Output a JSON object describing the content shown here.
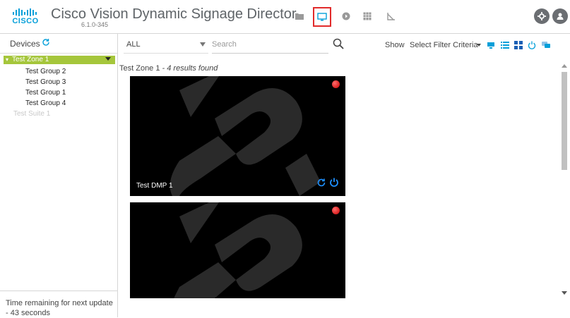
{
  "header": {
    "logo_text": "CISCO",
    "title": "Cisco Vision Dynamic Signage Director",
    "version": "6.1.0-345",
    "nav_icons": [
      "folder-icon",
      "monitor-icon",
      "play-icon",
      "calendar-icon",
      "chart-icon"
    ],
    "active_nav": "monitor-icon",
    "right_icons": [
      "settings-icon",
      "user-icon"
    ],
    "accent_color": "#049fd9",
    "highlight_color": "#e12b2b"
  },
  "sidebar": {
    "title": "Devices",
    "zone": {
      "label": "Test Zone 1",
      "color": "#a5c63b"
    },
    "groups": [
      "Test Group 2",
      "Test Group 3",
      "Test Group 1",
      "Test Group 4"
    ],
    "suite": "Test Suite 1",
    "status_text": "Time remaining for next update - 43 seconds"
  },
  "toolbar": {
    "filter_value": "ALL",
    "search_placeholder": "Search",
    "show_label": "Show",
    "criteria_label": "Select Filter Criteria",
    "view_icons": [
      "tile-view-icon",
      "list-view-icon",
      "grid-view-icon",
      "power-filter-icon",
      "chat-icon"
    ]
  },
  "content": {
    "results_zone": "Test Zone 1",
    "results_suffix": " - 4 results found",
    "cards": [
      {
        "name": "Test DMP 1",
        "status": "offline"
      },
      {
        "name": "",
        "status": "offline"
      }
    ]
  }
}
